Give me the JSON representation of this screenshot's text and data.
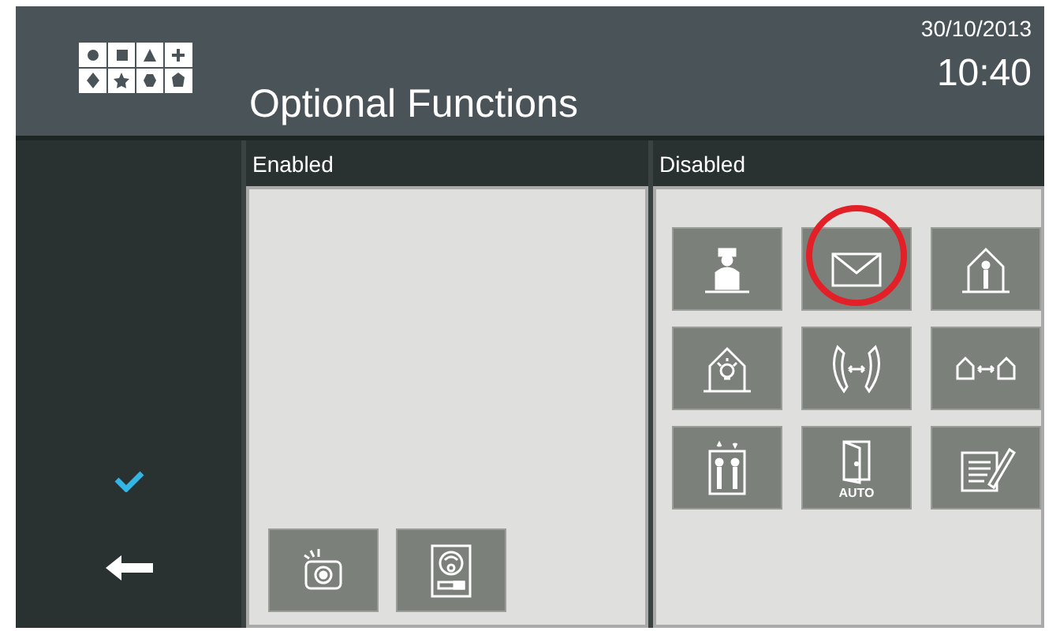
{
  "header": {
    "title": "Optional Functions",
    "date": "30/10/2013",
    "time": "10:40"
  },
  "sidebar": {
    "buttons": [
      {
        "kind": "confirm"
      },
      {
        "kind": "back"
      }
    ]
  },
  "panels": [
    {
      "title": "Enabled",
      "kind": "enabled",
      "tiles": [
        {
          "kind": "camera",
          "highlighted": false
        },
        {
          "kind": "door-panel",
          "highlighted": false
        }
      ]
    },
    {
      "title": "Disabled",
      "kind": "disabled",
      "tiles": [
        {
          "kind": "concierge",
          "highlighted": false
        },
        {
          "kind": "mail",
          "highlighted": true
        },
        {
          "kind": "house-person",
          "highlighted": false
        },
        {
          "kind": "house-light",
          "highlighted": false
        },
        {
          "kind": "call-transfer",
          "highlighted": false
        },
        {
          "kind": "house-link",
          "highlighted": false
        },
        {
          "kind": "lift",
          "highlighted": false
        },
        {
          "kind": "auto-door",
          "label": "AUTO",
          "highlighted": false
        },
        {
          "kind": "notes",
          "highlighted": false
        }
      ]
    }
  ]
}
